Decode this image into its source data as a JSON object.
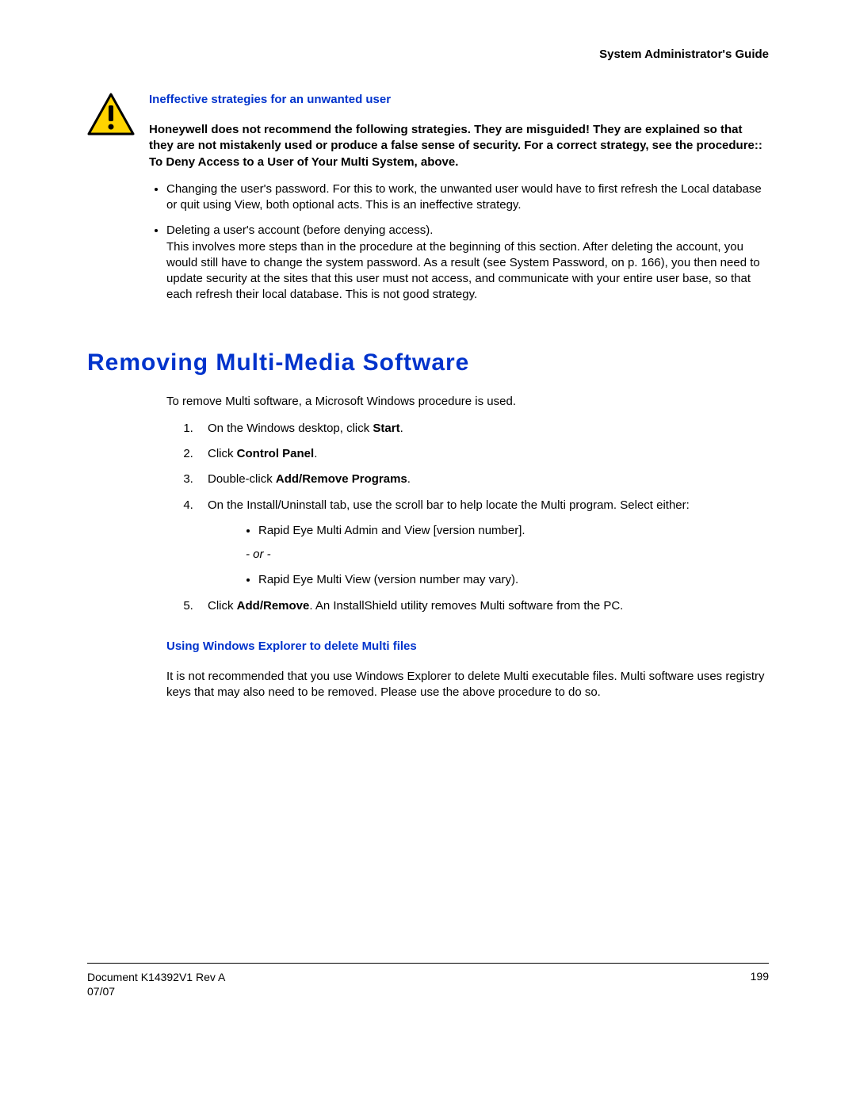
{
  "header": {
    "guide_title": "System Administrator's Guide"
  },
  "section1": {
    "subheading": "Ineffective strategies for an unwanted user",
    "warning_paragraph": "Honeywell does not recommend the following strategies. They are misguided! They are explained so that they are not mistakenly used or produce a false sense of security. For a correct strategy, see the procedure:: To Deny Access to a User of Your Multi System, above.",
    "bullets": {
      "b1": "Changing the user's password. For this to work, the unwanted user would have to first refresh the Local database or quit using View, both optional acts. This is an ineffective strategy.",
      "b2_line1": "Deleting a user's account (before denying access).",
      "b2_line2": "This involves more steps than in the procedure at the beginning of this section. After deleting the account, you would still have to change the system password. As a result (see System Password, on p. 166), you then need to update security at the sites that this user must not access, and communicate with your entire user base, so that each refresh their local database. This is not good strategy."
    }
  },
  "section2": {
    "heading": "Removing Multi-Media Software",
    "intro": "To remove Multi software, a Microsoft Windows procedure is used.",
    "steps": {
      "s1_pre": "On the Windows desktop, click ",
      "s1_bold": "Start",
      "s1_post": ".",
      "s2_pre": "Click ",
      "s2_bold": "Control Panel",
      "s2_post": ".",
      "s3_pre": "Double-click ",
      "s3_bold": "Add/Remove Programs",
      "s3_post": ".",
      "s4": "On the Install/Uninstall tab, use the scroll bar to help locate the Multi program. Select either:",
      "s4_sub1": "Rapid Eye Multi Admin and View [version number].",
      "s4_or": "- or -",
      "s4_sub2": "Rapid Eye Multi View (version number may vary).",
      "s5_pre": "Click ",
      "s5_bold": "Add/Remove",
      "s5_post": ". An InstallShield utility removes Multi software from the PC."
    },
    "sub2": {
      "subheading": "Using Windows Explorer to delete Multi files",
      "para": "It is not recommended that you use Windows Explorer to delete Multi executable files. Multi software uses registry keys that may also need to be removed. Please use the above procedure to do so."
    }
  },
  "footer": {
    "doc_line1": "Document K14392V1 Rev A",
    "doc_line2": "07/07",
    "page_number": "199"
  }
}
